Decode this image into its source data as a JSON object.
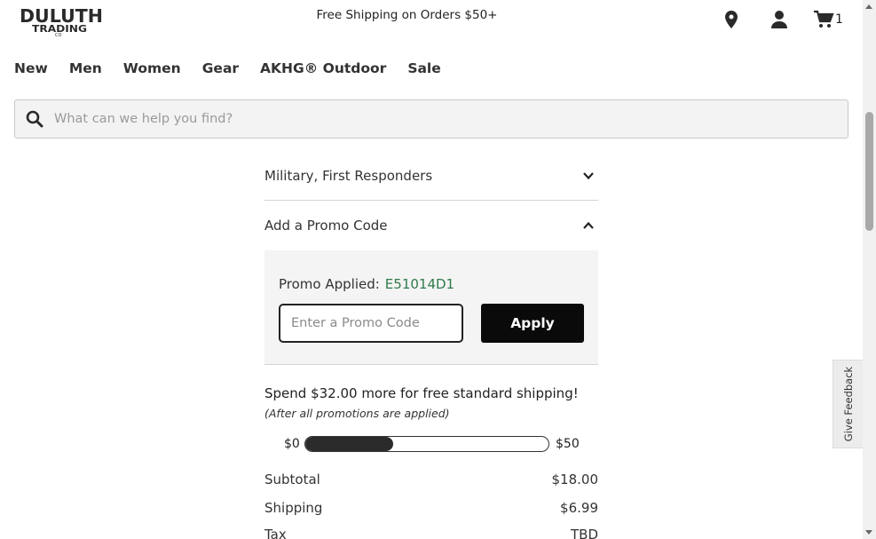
{
  "header": {
    "logo": {
      "line1": "DULUTH",
      "line2": "TRADING",
      "line3": "CO"
    },
    "shipping_message": "Free Shipping on Orders $50+",
    "cart_count": "1",
    "icons": [
      "location-icon",
      "account-icon",
      "cart-icon"
    ]
  },
  "nav": {
    "items": [
      {
        "label": "New"
      },
      {
        "label": "Men"
      },
      {
        "label": "Women"
      },
      {
        "label": "Gear"
      },
      {
        "label": "AKHG® Outdoor"
      },
      {
        "label": "Sale"
      }
    ]
  },
  "search": {
    "placeholder": "What can we help you find?",
    "value": ""
  },
  "accordion": {
    "military": {
      "label": "Military, First Responders",
      "state": "collapsed"
    },
    "promo": {
      "label": "Add a Promo Code",
      "state": "expanded"
    }
  },
  "promo": {
    "applied_label": "Promo Applied:",
    "applied_code": "E51014D1",
    "input_placeholder": "Enter a Promo Code",
    "input_value": "",
    "apply_label": "Apply"
  },
  "shipping_progress": {
    "message": "Spend $32.00 more for free standard shipping!",
    "note": "(After all promotions are applied)",
    "min_label": "$0",
    "max_label": "$50",
    "current": 18,
    "max": 50
  },
  "summary": {
    "rows": [
      {
        "label": "Subtotal",
        "value": "$18.00"
      },
      {
        "label": "Shipping",
        "value": "$6.99"
      },
      {
        "label": "Tax",
        "value": "TBD"
      }
    ]
  },
  "feedback_tab": {
    "label": "Give Feedback"
  },
  "colors": {
    "promo_code": "#2f7a4a",
    "apply_button": "#0a0a0a",
    "progress_fill": "#2b2b2b"
  }
}
